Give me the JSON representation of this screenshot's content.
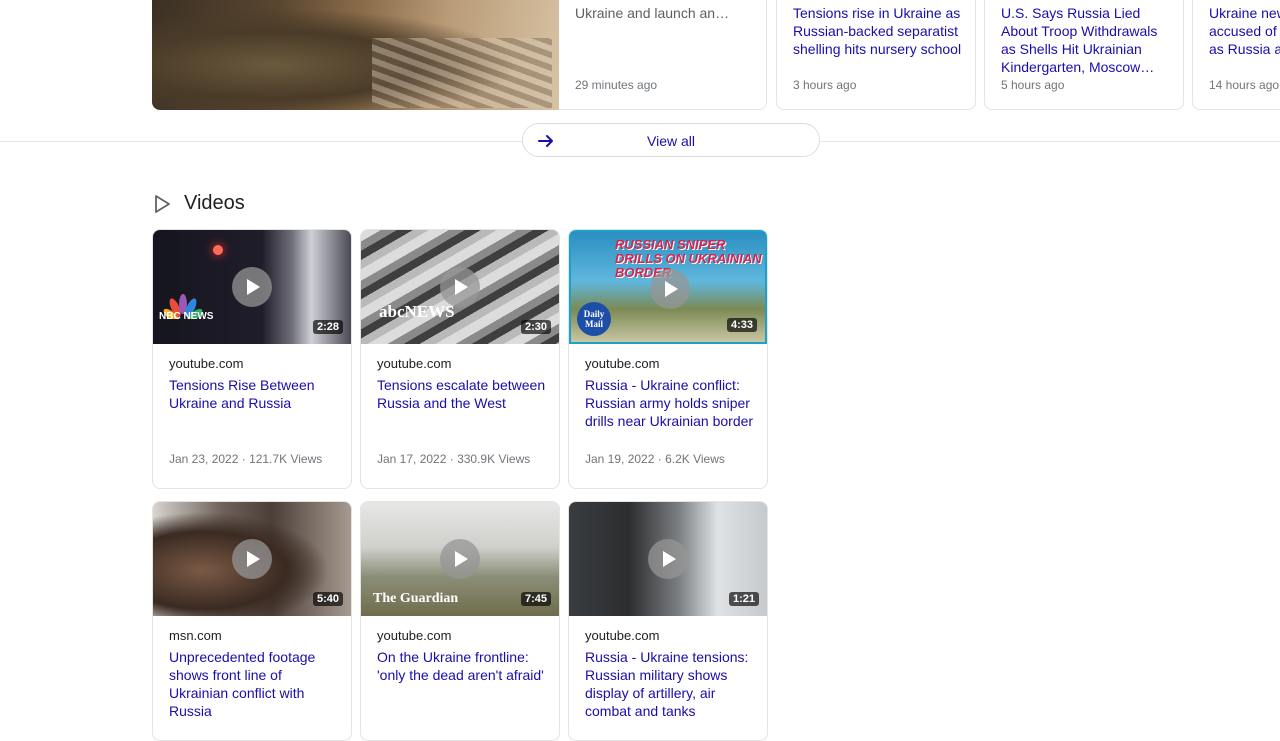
{
  "news": {
    "cards": [
      {
        "title": "fabricate a reason to invade Ukraine and launch an…",
        "time": "29 minutes ago"
      },
      {
        "title": "Tensions rise in Ukraine as Russian-backed separatist shelling hits nursery school",
        "time": "3 hours ago"
      },
      {
        "title": "U.S. Says Russia Lied About Troop Withdrawals as Shells Hit Ukrainian Kindergarten, Moscow…",
        "time": "5 hours ago"
      },
      {
        "title": "Ukraine news: accused of preschool, as Russia adds",
        "time": "14 hours ago"
      }
    ],
    "view_all_label": "View all"
  },
  "videos": {
    "section_title": "Videos",
    "items": [
      {
        "source": "youtube.com",
        "title": "Tensions Rise Between Ukraine and Russia",
        "date": "Jan 23, 2022",
        "views": "121.7K Views",
        "duration": "2:28",
        "logo": "NBC NEWS"
      },
      {
        "source": "youtube.com",
        "title": "Tensions escalate between Russia and the West",
        "date": "Jan 17, 2022",
        "views": "330.9K Views",
        "duration": "2:30",
        "logo": "abcNEWS"
      },
      {
        "source": "youtube.com",
        "title": "Russia - Ukraine conflict: Russian army holds sniper drills near Ukrainian border",
        "date": "Jan 19, 2022",
        "views": "6.2K Views",
        "duration": "4:33",
        "logo": "Daily Mail",
        "headline": "RUSSIAN SNIPER DRILLS ON UKRAINIAN BORDER"
      },
      {
        "source": "msn.com",
        "title": "Unprecedented footage shows front line of Ukrainian conflict with Russia",
        "duration": "5:40"
      },
      {
        "source": "youtube.com",
        "title": "On the Ukraine frontline: 'only the dead aren't afraid'",
        "duration": "7:45",
        "logo": "The Guardian"
      },
      {
        "source": "youtube.com",
        "title": "Russia - Ukraine tensions: Russian military shows display of artillery, air combat and tanks",
        "duration": "1:21"
      }
    ]
  },
  "colors": {
    "link": "#1a0dab",
    "meta": "#70757a",
    "text": "#202124"
  }
}
